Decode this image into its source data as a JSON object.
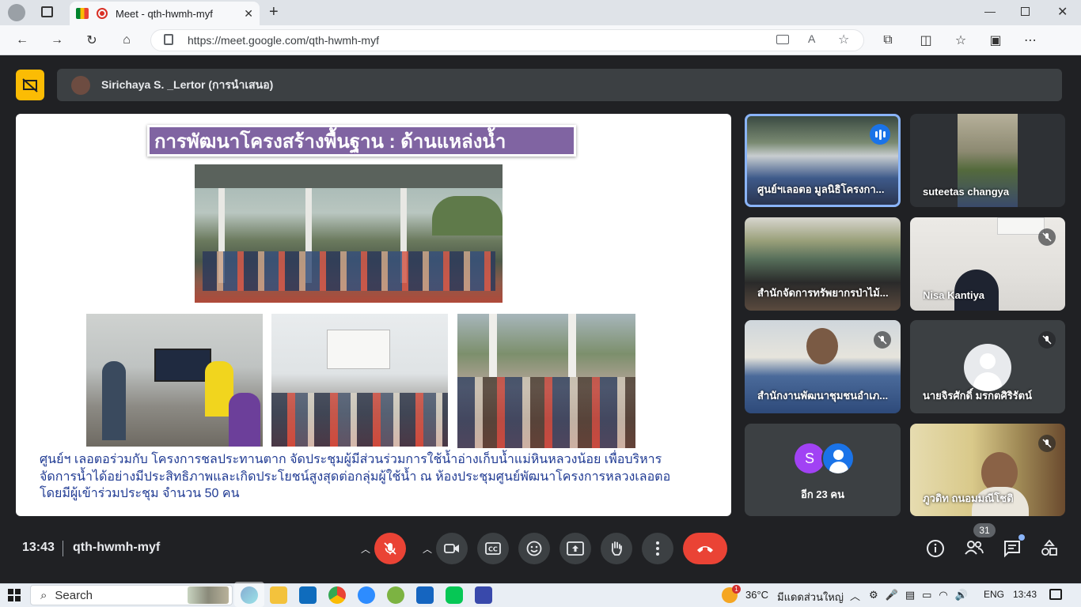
{
  "browser": {
    "tab_title": "Meet - qth-hwmh-myf",
    "url": "https://meet.google.com/qth-hwmh-myf"
  },
  "presenter": {
    "name": "Sirichaya S. _Lertor (การนำเสนอ)"
  },
  "slide": {
    "title": "การพัฒนาโครงสร้างพื้นฐาน :  ด้านแหล่งน้ำ",
    "caption_line1": "ศูนย์ฯ เลอตอร่วมกับ โครงการชลประทานตาก จัดประชุมผู้มีส่วนร่วมการใช้น้ำอ่างเก็บน้ำแม่หินหลวงน้อย เพื่อบริหาร",
    "caption_line2": "จัดการน้ำได้อย่างมีประสิทธิภาพและเกิดประโยชน์สูงสุดต่อกลุ่มผู้ใช้น้ำ ณ ห้องประชุมศูนย์พัฒนาโครงการหลวงเลอตอ",
    "caption_line3": "โดยมีผู้เข้าร่วมประชุม จำนวน 50 คน"
  },
  "participants": [
    {
      "name": "ศูนย์ฯเลอตอ มูลนิธิโครงกา..."
    },
    {
      "name": "suteetas changya"
    },
    {
      "name": "สำนักจัดการทรัพยากรป่าไม้..."
    },
    {
      "name": "Nisa Kantiya"
    },
    {
      "name": "สำนักงานพัฒนาชุมชนอำเภ..."
    },
    {
      "name": "นายจิรศักดิ์ มรกตศิริรัตน์"
    },
    {
      "name": "อีก 23 คน",
      "avatar_letter": "S"
    },
    {
      "name": "ภูวดิท ถนอมมณีโชติ"
    }
  ],
  "meeting": {
    "time": "13:43",
    "code": "qth-hwmh-myf",
    "people_count": "31"
  },
  "taskbar": {
    "search_label": "Search",
    "weather": "36°C",
    "weather_desc": "มีแดดส่วนใหญ่",
    "weather_badge": "1",
    "lang": "ENG",
    "clock": "13:43"
  },
  "colors": {
    "end_call": "#ea4335",
    "mic_off_red": "#ea4335",
    "title_bg": "#8064a2",
    "speaking_border": "#8ab4f8",
    "caption_blue": "#1f3a93"
  }
}
